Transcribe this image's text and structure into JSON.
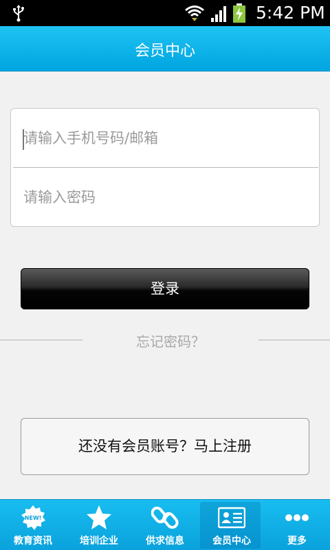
{
  "status_bar": {
    "time": "5:42 PM",
    "icons": [
      "usb-icon",
      "wifi-icon",
      "signal-icon",
      "battery-charging-icon"
    ]
  },
  "header": {
    "title": "会员中心"
  },
  "login": {
    "phone_placeholder": "请输入手机号码/邮箱",
    "password_placeholder": "请输入密码",
    "login_label": "登录",
    "forgot_label": "忘记密码？",
    "register_label": "还没有会员账号？马上注册"
  },
  "nav": {
    "items": [
      {
        "label": "教育资讯",
        "icon": "new-badge-icon",
        "badge": "NEW!"
      },
      {
        "label": "培训企业",
        "icon": "star-icon"
      },
      {
        "label": "供求信息",
        "icon": "link-icon"
      },
      {
        "label": "会员中心",
        "icon": "member-card-icon",
        "active": true
      },
      {
        "label": "更多",
        "icon": "more-dots-icon"
      }
    ]
  },
  "colors": {
    "accent": "#00a5e0",
    "button_dark": "#000000",
    "background": "#f1f1f1"
  }
}
